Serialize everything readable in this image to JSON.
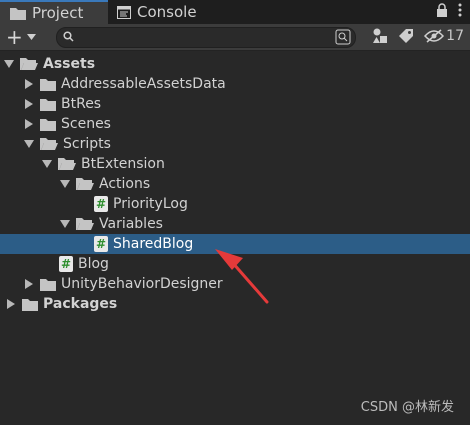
{
  "tabs": {
    "project": "Project",
    "console": "Console"
  },
  "toolbar": {
    "add_label": "+",
    "search_placeholder": "",
    "hidden_count": "17"
  },
  "tree": [
    {
      "label": "Assets",
      "bold": true,
      "expanded": true,
      "type": "folder"
    },
    {
      "label": "AddressableAssetsData",
      "type": "folder"
    },
    {
      "label": "BtRes",
      "type": "folder"
    },
    {
      "label": "Scenes",
      "type": "folder"
    },
    {
      "label": "Scripts",
      "type": "folder",
      "expanded": true
    },
    {
      "label": "BtExtension",
      "type": "folder",
      "expanded": true
    },
    {
      "label": "Actions",
      "type": "folder",
      "expanded": true
    },
    {
      "label": "PriorityLog",
      "type": "script"
    },
    {
      "label": "Variables",
      "type": "folder",
      "expanded": true
    },
    {
      "label": "SharedBlog",
      "type": "script",
      "selected": true
    },
    {
      "label": "Blog",
      "type": "script"
    },
    {
      "label": "UnityBehaviorDesigner",
      "type": "folder"
    },
    {
      "label": "Packages",
      "bold": true,
      "type": "folder"
    }
  ],
  "watermark": "CSDN @林新发",
  "colors": {
    "selection": "#2c5d87",
    "accent_tab": "#3a79bb",
    "annotation_arrow": "#e53a3a"
  }
}
